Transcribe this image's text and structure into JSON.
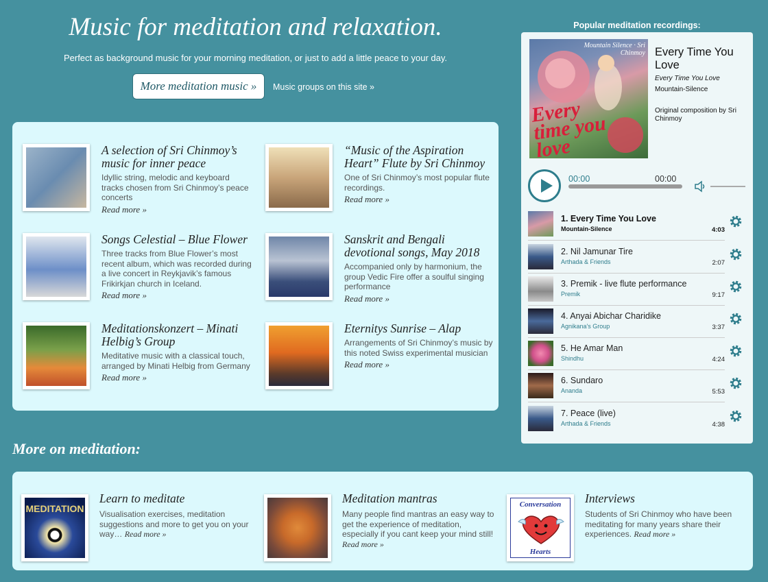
{
  "hero": {
    "title": "Music for meditation and relaxation.",
    "subtitle": "Perfect as background music for your morning meditation, or just to add a little peace to your day.",
    "more_button": "More meditation music »",
    "groups_link": "Music groups on this site »"
  },
  "items": [
    {
      "title": "A selection of Sri Chinmoy’s music for inner peace",
      "desc": "Idyllic string, melodic and keyboard tracks chosen from Sri Chinmoy’s peace concerts",
      "more": "Read more »"
    },
    {
      "title": "“Music of the Aspiration Heart” Flute by Sri Chinmoy",
      "desc": "One of Sri Chinmoy’s most popular flute recordings.",
      "more": "Read more »"
    },
    {
      "title": "Songs Celestial – Blue Flower",
      "desc": "Three tracks from Blue Flower’s most recent album, which was recorded during a live concert in Reykjavik’s famous Frikirkjan church in Iceland.",
      "more": "Read more »"
    },
    {
      "title": "Sanskrit and Bengali devotional songs, May 2018",
      "desc": "Accompanied only by harmonium, the group Vedic Fire offer a soulful singing performance",
      "more": "Read more »"
    },
    {
      "title": "Meditationskonzert – Minati Helbig’s Group",
      "desc": "Meditative music with a classical touch, arranged by Minati Helbig from Germany",
      "more": "Read more »"
    },
    {
      "title": "Eternitys Sunrise – Alap",
      "desc": "Arrangements of Sri Chinmoy’s music by this noted Swiss experimental musician",
      "more": "Read more »"
    }
  ],
  "more_heading": "More on meditation:",
  "bottom": [
    {
      "title": "Learn to meditate",
      "desc": "Visualisation exercises, meditation suggestions and more to get you on your way…",
      "more": "Read more »",
      "thumb_text": "MEDITATION"
    },
    {
      "title": "Meditation mantras",
      "desc": "Many people find mantras an easy way to get the experience of meditation, especially if you cant keep your mind still!",
      "more": "Read more »"
    },
    {
      "title": "Interviews",
      "desc": "Students of Sri Chinmoy who have been meditating for many years share their experiences.",
      "more": "Read more »",
      "thumb_text_top": "Conversation",
      "thumb_text_bottom": "Hearts"
    }
  ],
  "sidebar": {
    "heading": "Popular meditation recordings:",
    "now_playing": {
      "title": "Every Time You Love",
      "subtitle": "Every Time You Love",
      "artist": "Mountain-Silence",
      "composition": "Original composition by Sri Chinmoy",
      "art_text": "Every time you love",
      "art_label": "Mountain Silence · Sri Chinmoy"
    },
    "player": {
      "current": "00:00",
      "duration": "00:00",
      "progress": 0
    },
    "tracks": [
      {
        "title": "1. Every Time You Love",
        "artist": "Mountain-Silence",
        "duration": "4:03"
      },
      {
        "title": "2. Nil Jamunar Tire",
        "artist": "Arthada & Friends",
        "duration": "2:07"
      },
      {
        "title": "3. Premik - live flute performance",
        "artist": "Premik",
        "duration": "9:17"
      },
      {
        "title": "4. Anyai Abichar Charidike",
        "artist": "Agnikana's Group",
        "duration": "3:37"
      },
      {
        "title": "5. He Amar Man",
        "artist": "Shindhu",
        "duration": "4:24"
      },
      {
        "title": "6. Sundaro",
        "artist": "Ananda",
        "duration": "5:53"
      },
      {
        "title": "7. Peace (live)",
        "artist": "Arthada & Friends",
        "duration": "4:38"
      }
    ]
  },
  "colors": {
    "background": "#45919f",
    "panel": "#dcf9fd",
    "accent": "#2e7d8c"
  }
}
